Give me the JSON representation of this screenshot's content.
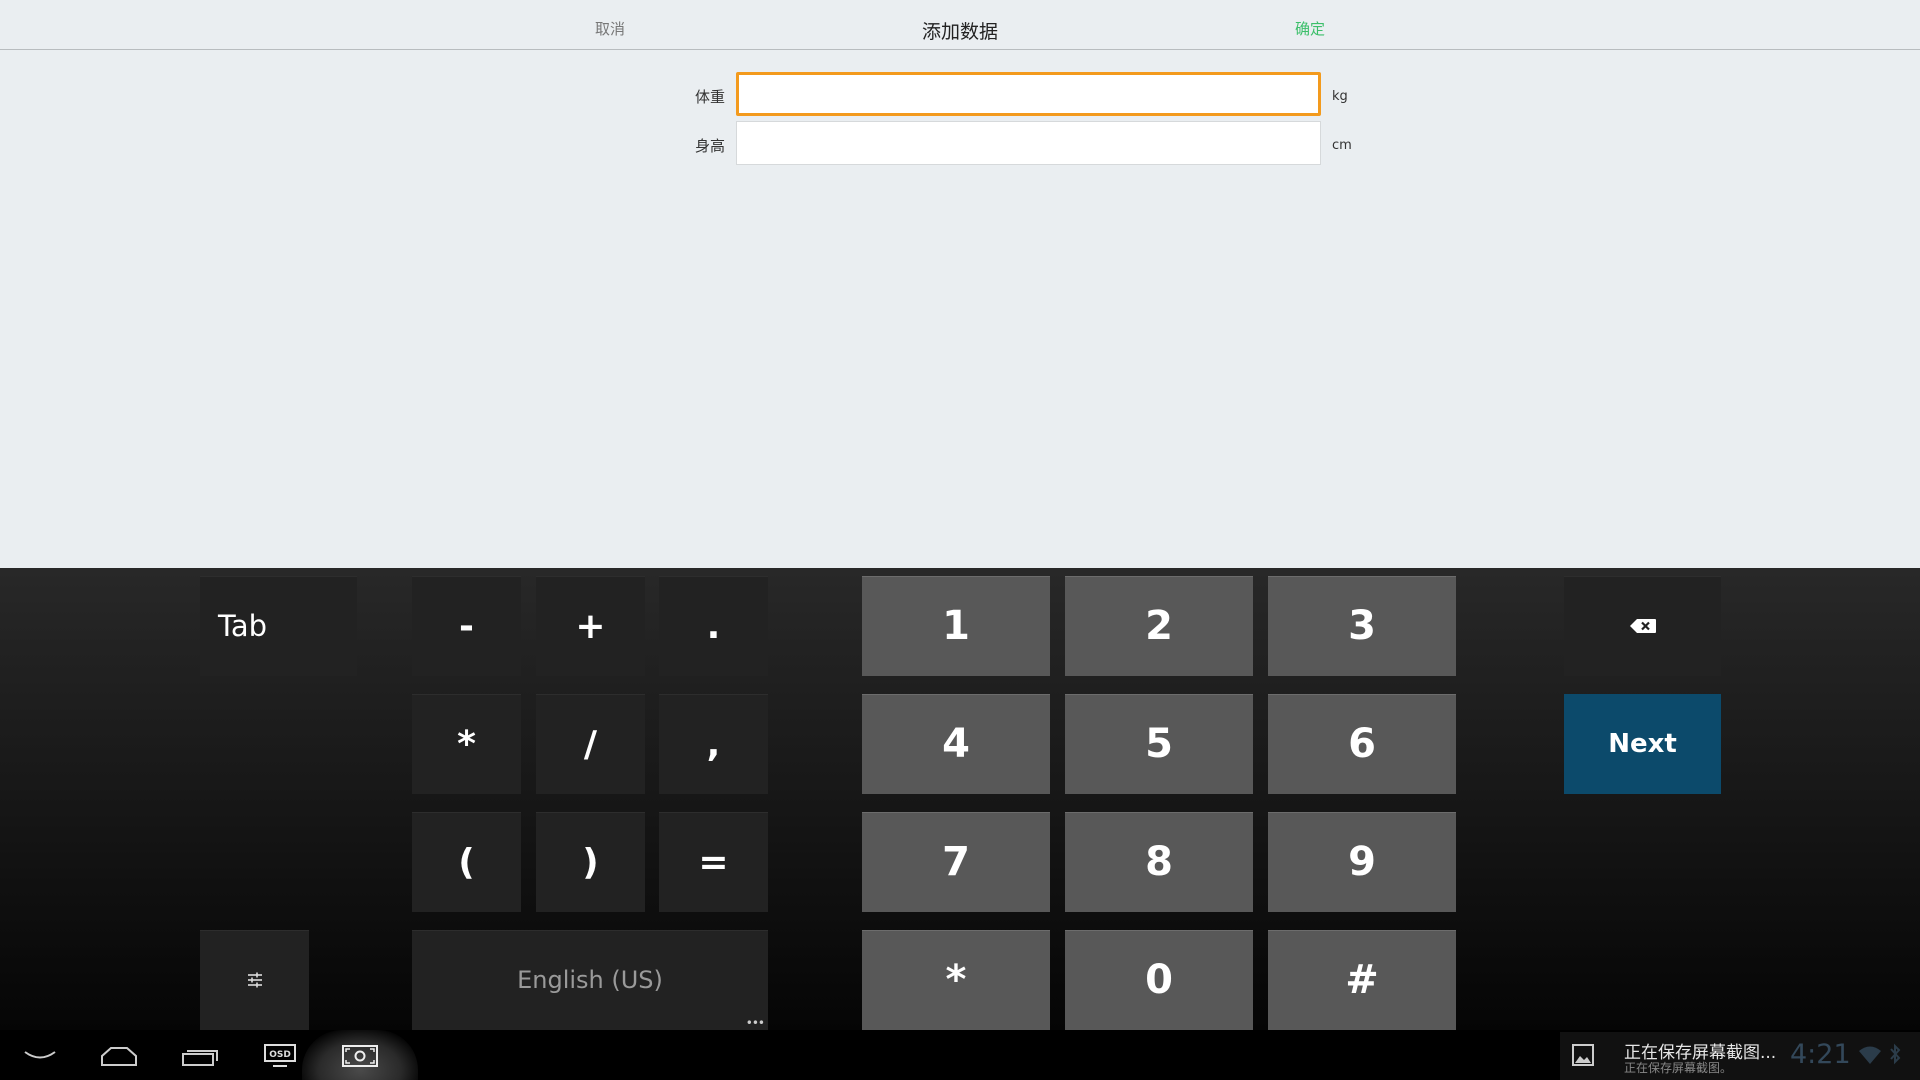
{
  "header": {
    "cancel": "取消",
    "title": "添加数据",
    "confirm": "确定",
    "confirm_color": "#3cbf6a"
  },
  "form": {
    "fields": [
      {
        "label": "体重",
        "value": "",
        "unit": "kg",
        "focused": true
      },
      {
        "label": "身高",
        "value": "",
        "unit": "cm",
        "focused": false
      }
    ],
    "focus_color": "#f39a1d"
  },
  "keyboard": {
    "tab": "Tab",
    "symbols": [
      "-",
      "+",
      ".",
      "*",
      "/",
      ",",
      "(",
      ")",
      "="
    ],
    "digits": [
      "1",
      "2",
      "3",
      "4",
      "5",
      "6",
      "7",
      "8",
      "9",
      "*",
      "0",
      "#"
    ],
    "settings_icon": "settings-sliders-icon",
    "language": "English (US)",
    "backspace_icon": "backspace-icon",
    "next": "Next",
    "next_color": "#0c4a6b"
  },
  "system_bar": {
    "nav_icons": [
      "hide-keyboard-icon",
      "home-icon",
      "recent-apps-icon",
      "osd-icon",
      "screenshot-icon"
    ],
    "osd_label": "OSD",
    "notification": {
      "icon": "image-icon",
      "title": "正在保存屏幕截图...",
      "subtitle": "正在保存屏幕截图。"
    },
    "clock": "4:21",
    "status_icons": [
      "wifi-icon",
      "bluetooth-icon"
    ]
  }
}
